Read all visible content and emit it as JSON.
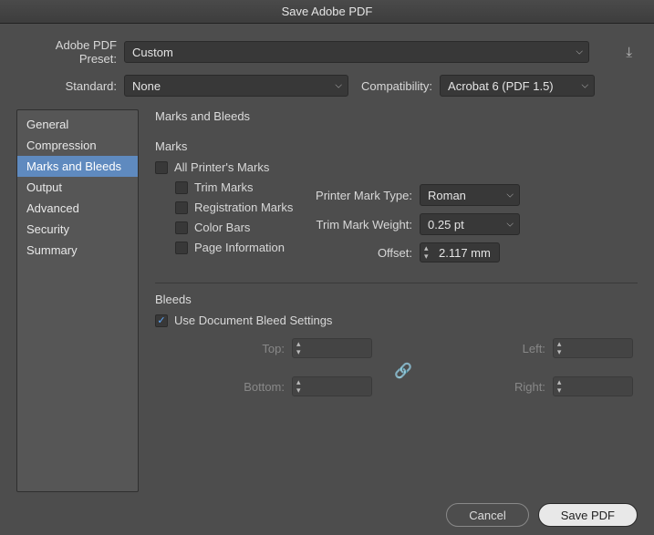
{
  "window": {
    "title": "Save Adobe PDF"
  },
  "preset": {
    "label": "Adobe PDF Preset:",
    "value": "Custom"
  },
  "standard": {
    "label": "Standard:",
    "value": "None"
  },
  "compatibility": {
    "label": "Compatibility:",
    "value": "Acrobat 6 (PDF 1.5)"
  },
  "sidebar": {
    "items": [
      {
        "label": "General"
      },
      {
        "label": "Compression"
      },
      {
        "label": "Marks and Bleeds"
      },
      {
        "label": "Output"
      },
      {
        "label": "Advanced"
      },
      {
        "label": "Security"
      },
      {
        "label": "Summary"
      }
    ]
  },
  "panel": {
    "title": "Marks and Bleeds",
    "marks": {
      "header": "Marks",
      "all": "All Printer's Marks",
      "trim": "Trim Marks",
      "registration": "Registration Marks",
      "color_bars": "Color Bars",
      "page_info": "Page Information",
      "printer_mark_type": {
        "label": "Printer Mark Type:",
        "value": "Roman"
      },
      "trim_mark_weight": {
        "label": "Trim Mark Weight:",
        "value": "0.25 pt"
      },
      "offset": {
        "label": "Offset:",
        "value": "2.117 mm"
      }
    },
    "bleeds": {
      "header": "Bleeds",
      "use_doc": "Use Document Bleed Settings",
      "top": {
        "label": "Top:",
        "value": ""
      },
      "bottom": {
        "label": "Bottom:",
        "value": ""
      },
      "left": {
        "label": "Left:",
        "value": ""
      },
      "right": {
        "label": "Right:",
        "value": ""
      }
    }
  },
  "buttons": {
    "cancel": "Cancel",
    "save": "Save PDF"
  }
}
